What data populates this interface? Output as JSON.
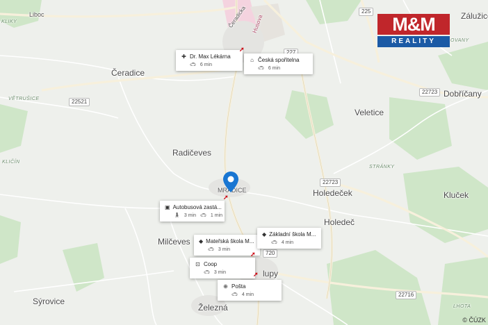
{
  "logo": {
    "brand": "M&M",
    "tagline": "REALITY"
  },
  "copyright": "© ČÚZK",
  "places": {
    "zaluzice": "Záluži­ce",
    "ceradice": "Čeradice",
    "dobricany": "Dobříčany",
    "veletice": "Veletice",
    "radiceves": "Radičeves",
    "holedecek": "Holedeček",
    "klucek": "Kluček",
    "holedec": "Holedeč",
    "milceves": "Milčeves",
    "syrovice": "Sýrovice",
    "zelezna": "Železná",
    "lupy": "lupy",
    "mradice": "MRADICE",
    "liboc": "Liboc",
    "cer": "Čeradicka",
    "husova": "Husova",
    "klicky": "KLIKY",
    "vetrusice": "VĚTRUŠICE",
    "klicin": "KLIČÍN",
    "stranky": "STRÁNKY",
    "lhota": "LHOTA",
    "ovany": "OVANY"
  },
  "roads": [
    "225",
    "227",
    "22521",
    "22723",
    "22723",
    "22716",
    "720"
  ],
  "pois": [
    {
      "name": "Dr. Max Lékárna",
      "icon": "pharmacy-icon",
      "glyph": "✚",
      "car": "6 min"
    },
    {
      "name": "Česká spořitelna",
      "icon": "bank-icon",
      "glyph": "⌂",
      "car": "6 min"
    },
    {
      "name": "Autobusová zastá...",
      "icon": "bus-icon",
      "glyph": "▣",
      "walk": "3 min",
      "car": "1 min"
    },
    {
      "name": "Mateřská škola M...",
      "icon": "school-icon",
      "glyph": "◆",
      "car": "3 min"
    },
    {
      "name": "Základní škola M...",
      "icon": "school-icon",
      "glyph": "◆",
      "car": "4 min"
    },
    {
      "name": "Coop",
      "icon": "shopping-cart-icon",
      "glyph": "⊡",
      "car": "3 min"
    },
    {
      "name": "Pošta",
      "icon": "post-office-icon",
      "glyph": "⊕",
      "car": "4 min"
    }
  ]
}
